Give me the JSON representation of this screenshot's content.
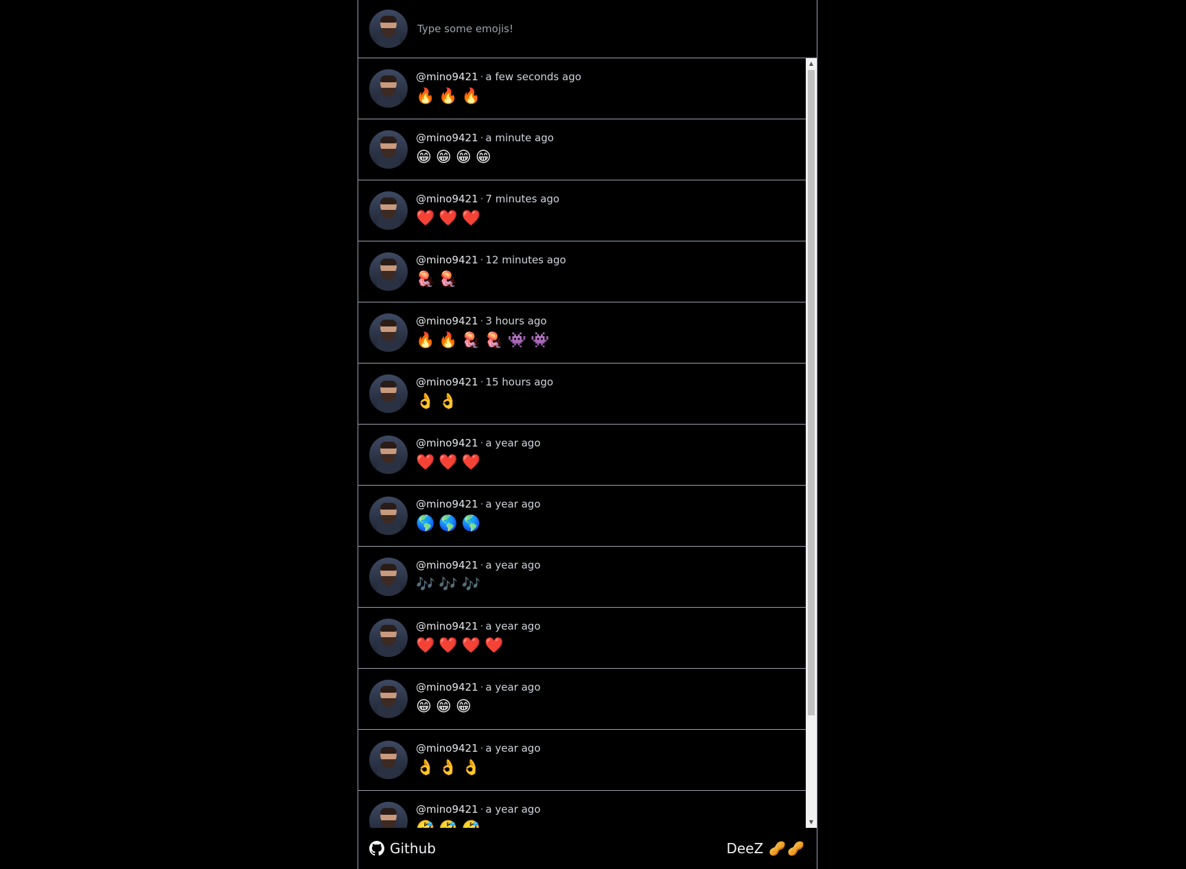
{
  "composer": {
    "placeholder": "Type some emojis!"
  },
  "posts": [
    {
      "user": "@mino9421",
      "time": "a few seconds ago",
      "emojis": "🔥🔥🔥"
    },
    {
      "user": "@mino9421",
      "time": "a minute ago",
      "emojis": "😁😁😁😁"
    },
    {
      "user": "@mino9421",
      "time": "7 minutes ago",
      "emojis": "❤️❤️❤️"
    },
    {
      "user": "@mino9421",
      "time": "12 minutes ago",
      "emojis": "🪼🪼"
    },
    {
      "user": "@mino9421",
      "time": "3 hours ago",
      "emojis": "🔥🔥🪼🪼👾👾"
    },
    {
      "user": "@mino9421",
      "time": "15 hours ago",
      "emojis": "👌👌"
    },
    {
      "user": "@mino9421",
      "time": "a year ago",
      "emojis": "❤️❤️❤️"
    },
    {
      "user": "@mino9421",
      "time": "a year ago",
      "emojis": "🌎🌎🌎"
    },
    {
      "user": "@mino9421",
      "time": "a year ago",
      "emojis": "🎶🎶🎶"
    },
    {
      "user": "@mino9421",
      "time": "a year ago",
      "emojis": "❤️❤️❤️❤️"
    },
    {
      "user": "@mino9421",
      "time": "a year ago",
      "emojis": "😁😁😁"
    },
    {
      "user": "@mino9421",
      "time": "a year ago",
      "emojis": "👌👌👌"
    },
    {
      "user": "@mino9421",
      "time": "a year ago",
      "emojis": "🤣🤣🤣"
    }
  ],
  "meta_separator": "·",
  "footer": {
    "github_label": "Github",
    "brand_label": "DeeZ",
    "brand_emoji": "🥜🥜"
  },
  "icons": {
    "github": "github-icon"
  },
  "colors": {
    "background": "#000000",
    "border": "#9ca3af",
    "text": "#e5e7eb"
  }
}
